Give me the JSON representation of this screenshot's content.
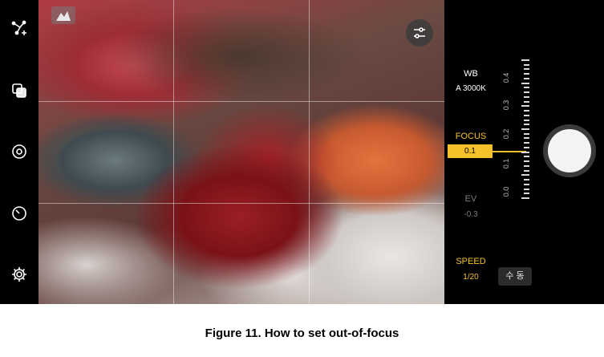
{
  "caption": "Figure 11. How to set out-of-focus",
  "left_bar": {
    "icons": [
      "selfie-transform-icon",
      "layers-icon",
      "camera-switch-icon",
      "timer-icon",
      "settings-icon"
    ]
  },
  "viewfinder": {
    "histogram_icon": "histogram-icon",
    "adjust_icon": "sliders-icon"
  },
  "pro_panel": {
    "wb_label": "WB",
    "wb_value": "A 3000K",
    "focus_label": "FOCUS",
    "focus_value": "0.1",
    "ev_label": "EV",
    "ev_value": "-0.3",
    "speed_label": "SPEED",
    "speed_value": "1/20",
    "manual_button": "수 동",
    "ruler_labels": [
      "0.4",
      "0.3",
      "0.2",
      "0.1",
      "0.0"
    ],
    "focus_level": 0.1,
    "accent_color": "#f6c12a"
  }
}
